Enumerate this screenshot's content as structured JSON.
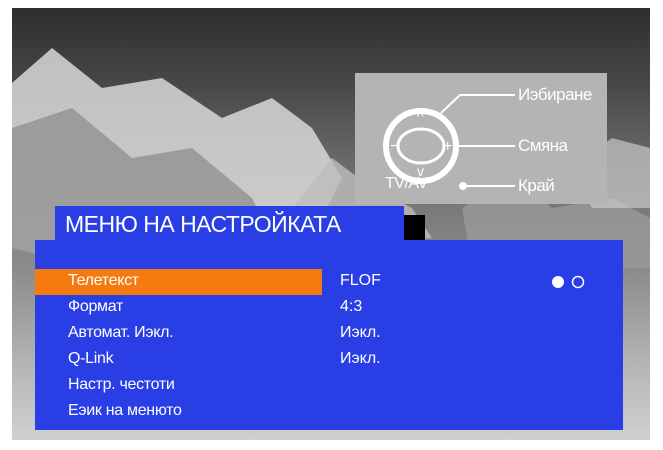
{
  "help": {
    "select_label": "Иэбиране",
    "change_label": "Смяна",
    "source_label": "TV/AV",
    "exit_label": "Край"
  },
  "menu": {
    "title": "МЕНЮ НА НАСТРОЙКАТА",
    "items": [
      {
        "label": "Телетекст",
        "value": "FLOF",
        "selected": true
      },
      {
        "label": "Формат",
        "value": "4:3"
      },
      {
        "label": "Автомат. Иэкл.",
        "value": "Иэкл."
      },
      {
        "label": "Q-Link",
        "value": "Иэкл."
      },
      {
        "label": "Настр. честоти",
        "value": ""
      },
      {
        "label": "Еэик на менюто",
        "value": ""
      }
    ],
    "page_indicator": {
      "total": 2,
      "current": 1
    }
  },
  "colors": {
    "menu_bg": "#2a3ee6",
    "highlight": "#f57a10",
    "help_bg": "#b4b4b4"
  }
}
